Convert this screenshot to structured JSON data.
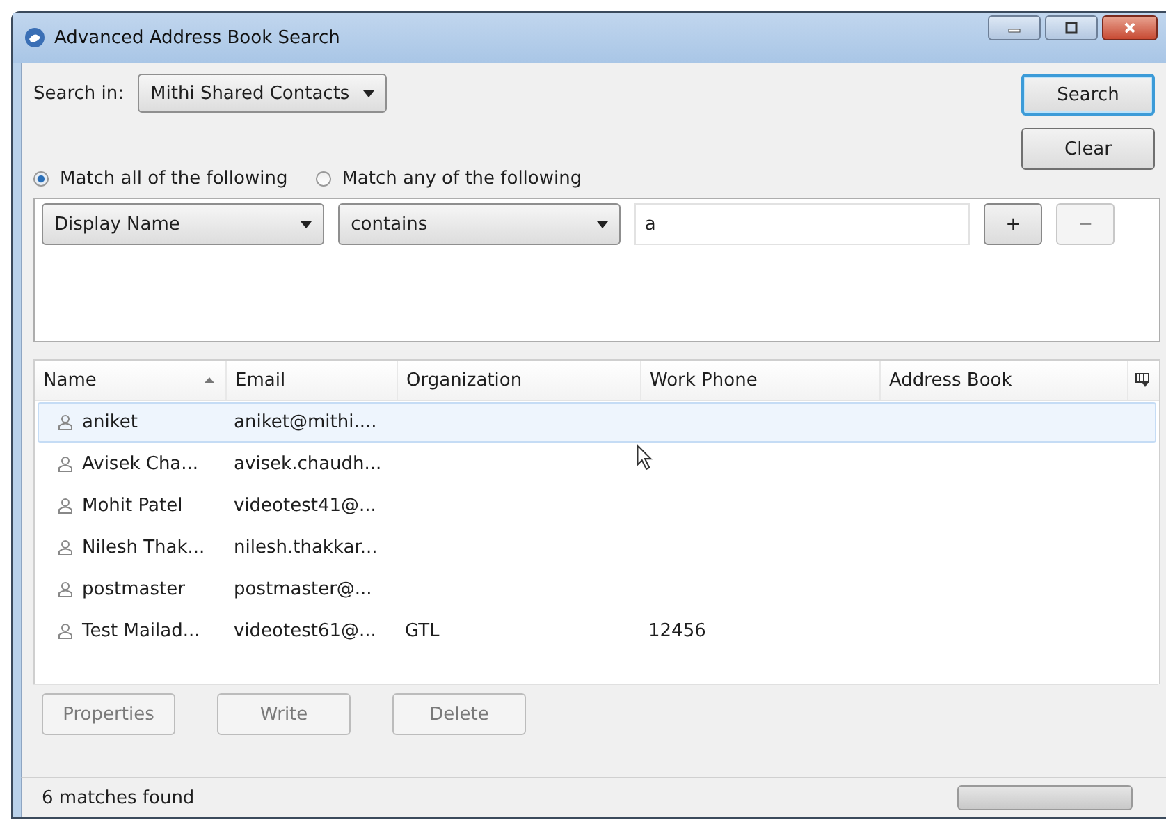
{
  "window": {
    "title": "Advanced Address Book Search"
  },
  "search_in": {
    "label": "Search in:",
    "value": "Mithi Shared Contacts"
  },
  "actions": [
    {
      "label": "Search",
      "focused": true
    },
    {
      "label": "Clear",
      "focused": false
    }
  ],
  "match_options": [
    {
      "label": "Match all of the following",
      "selected": true
    },
    {
      "label": "Match any of the following",
      "selected": false
    }
  ],
  "criteria": [
    {
      "field": "Display Name",
      "operator": "contains",
      "value": "a",
      "add": "+",
      "remove": "−",
      "remove_disabled": true
    }
  ],
  "table": {
    "columns": [
      {
        "label": "Name",
        "sorted": true
      },
      {
        "label": "Email",
        "sorted": false
      },
      {
        "label": "Organization",
        "sorted": false
      },
      {
        "label": "Work Phone",
        "sorted": false
      },
      {
        "label": "Address Book",
        "sorted": false
      }
    ],
    "rows": [
      {
        "cells": [
          "aniket",
          "aniket@mithi....",
          "",
          "",
          ""
        ],
        "selected": true
      },
      {
        "cells": [
          "Avisek  Cha...",
          "avisek.chaudh...",
          "",
          "",
          ""
        ],
        "selected": false
      },
      {
        "cells": [
          "Mohit Patel",
          "videotest41@...",
          "",
          "",
          ""
        ],
        "selected": false
      },
      {
        "cells": [
          "Nilesh Thak...",
          "nilesh.thakkar...",
          "",
          "",
          ""
        ],
        "selected": false
      },
      {
        "cells": [
          "postmaster",
          "postmaster@...",
          "",
          "",
          ""
        ],
        "selected": false
      },
      {
        "cells": [
          "Test Mailad...",
          "videotest61@...",
          "GTL",
          "12456",
          ""
        ],
        "selected": false
      }
    ]
  },
  "bottom_buttons": [
    {
      "label": "Properties",
      "disabled": true
    },
    {
      "label": "Write",
      "disabled": true
    },
    {
      "label": "Delete",
      "disabled": true
    }
  ],
  "status_bar": {
    "text": "6 matches found",
    "progress": {
      "level": 0
    }
  }
}
